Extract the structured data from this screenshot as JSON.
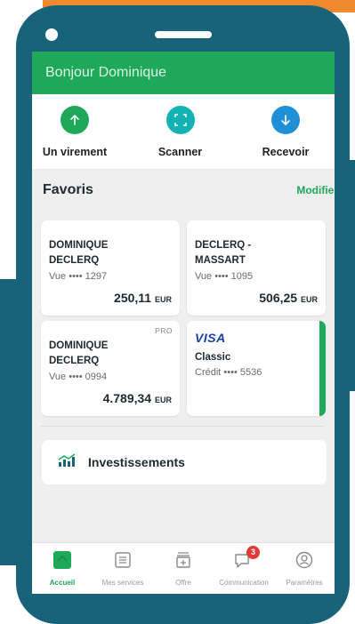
{
  "colors": {
    "accent_green": "#1fa75a",
    "brand_teal": "#18637a",
    "orange": "#f08a2c",
    "badge_red": "#e53935"
  },
  "header": {
    "greeting": "Bonjour Dominique"
  },
  "quick_actions": [
    {
      "label": "Un virement",
      "icon": "arrow-up-icon",
      "color": "#1fa75a"
    },
    {
      "label": "Scanner",
      "icon": "scan-icon",
      "color": "#14b3b3"
    },
    {
      "label": "Recevoir",
      "icon": "arrow-down-icon",
      "color": "#1f8fd6"
    }
  ],
  "favoris": {
    "title": "Favoris",
    "edit_label": "Modifier",
    "cards": [
      {
        "name_line1": "DOMINIQUE",
        "name_line2": "DECLERQ",
        "account": "Vue •••• 1297",
        "balance": "250,11",
        "currency": "EUR"
      },
      {
        "name_line1": "DECLERQ -",
        "name_line2": "MASSART",
        "account": "Vue •••• 1095",
        "balance": "506,25",
        "currency": "EUR"
      },
      {
        "badge": "PRO",
        "name_line1": "DOMINIQUE",
        "name_line2": "DECLERQ",
        "account": "Vue •••• 0994",
        "balance": "4.789,34",
        "currency": "EUR"
      },
      {
        "brand": "VISA",
        "name_line1": "Classic",
        "account": "Crédit •••• 5536"
      }
    ]
  },
  "investments": {
    "label": "Investissements",
    "icon": "chart-growth-icon"
  },
  "tabbar": {
    "items": [
      {
        "label": "Accueil",
        "icon": "home-icon",
        "active": true
      },
      {
        "label": "Mes services",
        "icon": "list-icon"
      },
      {
        "label": "Offre",
        "icon": "offer-icon"
      },
      {
        "label": "Communication",
        "icon": "chat-icon",
        "badge": "3"
      },
      {
        "label": "Paramètres",
        "icon": "settings-icon"
      }
    ]
  }
}
